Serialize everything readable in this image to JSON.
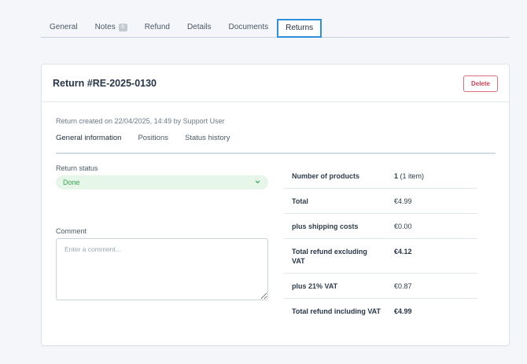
{
  "tabs": [
    {
      "label": "General"
    },
    {
      "label": "Notes",
      "badge": "0"
    },
    {
      "label": "Refund"
    },
    {
      "label": "Details"
    },
    {
      "label": "Documents"
    },
    {
      "label": "Returns"
    }
  ],
  "card": {
    "title": "Return #RE-2025-0130",
    "delete_label": "Delete",
    "meta": "Return created on 22/04/2025, 14:49 by Support User",
    "subtabs": [
      {
        "label": "General information"
      },
      {
        "label": "Positions"
      },
      {
        "label": "Status history"
      }
    ],
    "status_label": "Return status",
    "status_value": "Done",
    "comment_label": "Comment",
    "comment_placeholder": "Enter a comment..."
  },
  "summary": {
    "rows": [
      {
        "key": "Number of products",
        "value_strong": "1",
        "value": " (1 item)"
      },
      {
        "key": "Total",
        "value": "€4.99"
      },
      {
        "key": "plus shipping costs",
        "value": "€0.00"
      },
      {
        "key": "Total refund excluding VAT",
        "value": "€4.12"
      },
      {
        "key": "plus 21% VAT",
        "value": "€0.87"
      },
      {
        "key": "Total refund including VAT",
        "value": "€4.99"
      }
    ]
  },
  "colors": {
    "accent": "#2f8fd8",
    "danger": "#d04554",
    "success": "#35a852",
    "success_bg": "#e6f6e9"
  }
}
